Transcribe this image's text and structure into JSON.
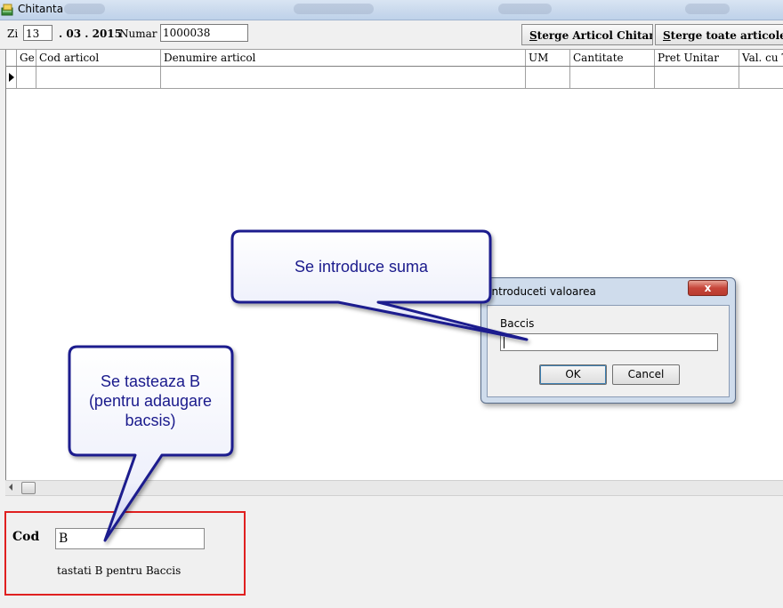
{
  "window": {
    "title": "Chitanta"
  },
  "toolbar": {
    "zi_label": "Zi",
    "zi_value": "13",
    "date_rest": ". 03 . 2015",
    "numar_label": "Numar :",
    "numar_value": "1000038",
    "btn_sterge_articol_u": "S",
    "btn_sterge_articol_rest": "terge  Articol Chitanta",
    "btn_sterge_toate_u": "S",
    "btn_sterge_toate_rest": "terge toate articolele chi"
  },
  "grid": {
    "columns": [
      "Ge",
      "Cod articol",
      "Denumire articol",
      "UM",
      "Cantitate",
      "Pret Unitar",
      "Val. cu TV"
    ]
  },
  "cod_panel": {
    "label": "Cod",
    "value": "B",
    "hint": "tastati B pentru Baccis"
  },
  "dialog": {
    "title": "Introduceti valoarea",
    "close_glyph": "x",
    "field_label": "Baccis",
    "field_value": "",
    "ok_label": "OK",
    "cancel_label": "Cancel"
  },
  "callouts": {
    "top_text": "Se introduce suma",
    "bottom_line1": "Se tasteaza B",
    "bottom_line2": "(pentru adaugare",
    "bottom_line3": "bacsis)"
  },
  "colors": {
    "callout_text": "#1a1a8c",
    "callout_border": "#1c1f8e",
    "highlight_box": "#e02020"
  }
}
